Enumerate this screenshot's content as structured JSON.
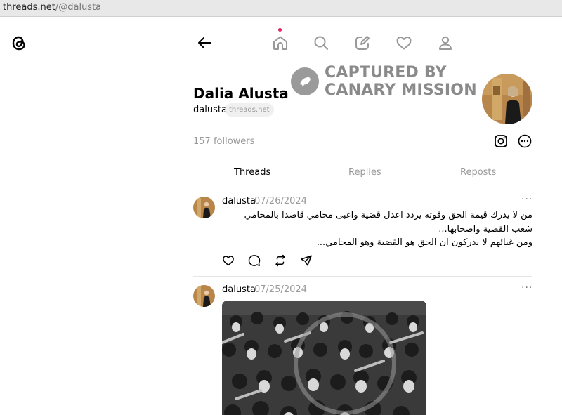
{
  "browser": {
    "url_host": "threads.net",
    "url_path": "/@dalusta"
  },
  "watermark": {
    "line1": "CAPTURED BY",
    "line2": "CANARY MISSION"
  },
  "profile": {
    "name": "Dalia Alusta",
    "handle": "dalusta",
    "domain_badge": "threads.net",
    "followers": "157 followers"
  },
  "tabs": [
    {
      "label": "Threads",
      "active": true
    },
    {
      "label": "Replies",
      "active": false
    },
    {
      "label": "Reposts",
      "active": false
    }
  ],
  "posts": [
    {
      "user": "dalusta",
      "date": "07/26/2024",
      "lines": [
        "من لا يدرك قيمة الحق وقوته يردد اعدل قضية واغبى محامي قاصدا بالمحامي شعب القضية واصحابها...",
        "ومن غبائهم لا يدركون ان الحق هو القضية وهو المحامي..."
      ]
    },
    {
      "user": "dalusta",
      "date": "07/25/2024"
    }
  ],
  "icons": {
    "logo": "threads-logo-icon",
    "back": "back-arrow-icon",
    "home": "home-icon",
    "search": "search-icon",
    "compose": "compose-icon",
    "activity": "heart-icon",
    "profile": "profile-icon",
    "instagram": "instagram-icon",
    "more": "more-circle-icon",
    "like": "heart-icon",
    "comment": "comment-icon",
    "repost": "repost-icon",
    "share": "share-icon"
  },
  "colors": {
    "notification_dot": "#e0245e",
    "muted_text": "#999999",
    "watermark": "#8a8a8a"
  }
}
